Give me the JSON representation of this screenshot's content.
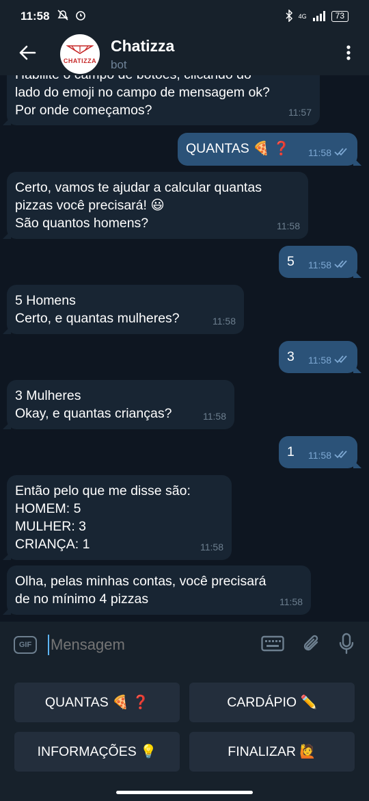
{
  "status": {
    "time": "11:58",
    "left_icons": [
      "silent-icon",
      "alarm-icon"
    ],
    "network": "4G",
    "battery": "73"
  },
  "header": {
    "title": "Chatizza",
    "subtitle": "bot",
    "avatar_text": "CHATIZZA"
  },
  "messages": [
    {
      "dir": "in",
      "text": "Habilite o campo de botões, clicando do\nlado do emoji no campo de mensagem ok?\nPor onde começamos?",
      "time": "11:57"
    },
    {
      "dir": "out",
      "text": "QUANTAS 🍕 ❓",
      "time": "11:58"
    },
    {
      "dir": "in",
      "text": "Certo, vamos te ajudar a calcular quantas\npizzas você precisará! 😃\nSão quantos homens?",
      "time": "11:58"
    },
    {
      "dir": "out",
      "text": "5",
      "time": "11:58"
    },
    {
      "dir": "in",
      "text": "5 Homens\nCerto, e quantas mulheres?",
      "time": "11:58"
    },
    {
      "dir": "out",
      "text": "3",
      "time": "11:58"
    },
    {
      "dir": "in",
      "text": "3 Mulheres\nOkay, e quantas crianças?",
      "time": "11:58"
    },
    {
      "dir": "out",
      "text": "1",
      "time": "11:58"
    },
    {
      "dir": "in",
      "text": "Então pelo que me disse são:\nHOMEM: 5\nMULHER: 3\nCRIANÇA: 1",
      "time": "11:58"
    },
    {
      "dir": "in",
      "text": "Olha, pelas minhas contas, você precisará\nde no mínimo 4 pizzas",
      "time": "11:58"
    }
  ],
  "input": {
    "placeholder": "Mensagem",
    "gif_label": "GIF"
  },
  "keyboard": {
    "buttons": [
      {
        "label": "QUANTAS 🍕 ❓"
      },
      {
        "label": "CARDÁPIO ✏️"
      },
      {
        "label": "INFORMAÇÕES 💡"
      },
      {
        "label": "FINALIZAR 🙋"
      }
    ]
  },
  "colors": {
    "background": "#0e1621",
    "header": "#17212b",
    "incoming_bubble": "#182533",
    "outgoing_bubble": "#2b5278",
    "accent": "#5eb5f7"
  }
}
